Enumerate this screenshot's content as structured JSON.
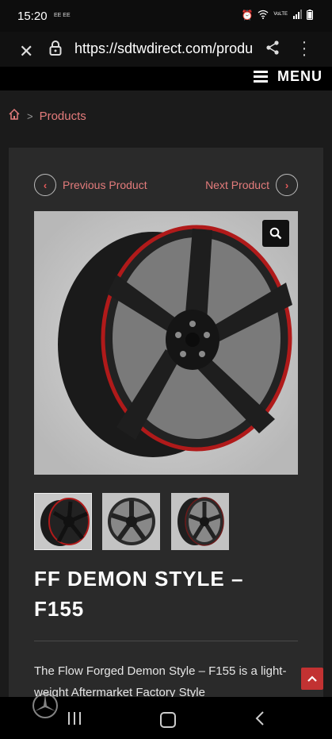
{
  "status_bar": {
    "time": "15:20",
    "small_text": "ЕЕ ЕЕ",
    "icons": [
      "alarm-icon",
      "wifi-icon",
      "lte-icon",
      "signal-icon",
      "battery-icon"
    ],
    "network": "VoLTE"
  },
  "browser": {
    "url": "https://sdtwdirect.com/products/ff-demon-style"
  },
  "header": {
    "menu_label": "MENU"
  },
  "breadcrumb": {
    "separator": ">",
    "current": "Products"
  },
  "product_nav": {
    "prev_label": "Previous Product",
    "next_label": "Next Product"
  },
  "product": {
    "title_line1": "FF DEMON STYLE –",
    "title_line2": "F155",
    "description": "The Flow Forged Demon Style – F155 is a light-weight Aftermarket Factory Style"
  },
  "colors": {
    "accent": "#e47c7c",
    "back_to_top": "#c23232",
    "card_bg": "#2a2a2a",
    "page_bg": "#1b1b1b"
  }
}
